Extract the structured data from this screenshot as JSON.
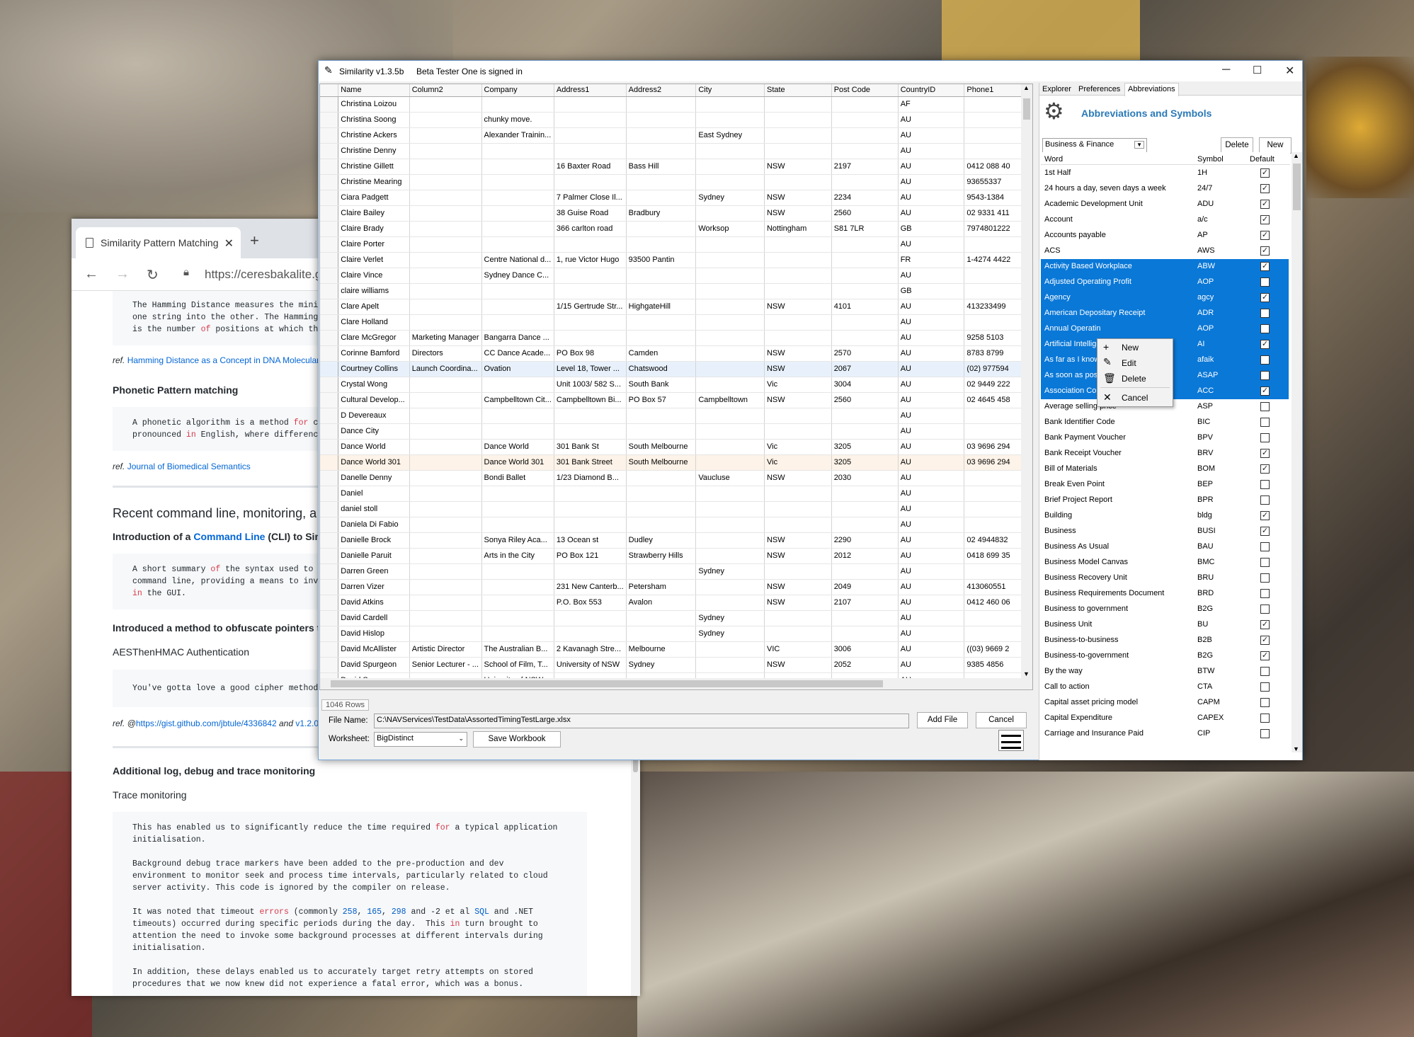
{
  "app": {
    "title": "Similarity v1.3.5b",
    "signed_in": "Beta Tester One is signed in",
    "columns": [
      "Name",
      "Column2",
      "Company",
      "Address1",
      "Address2",
      "City",
      "State",
      "Post Code",
      "CountryID",
      "Phone1"
    ],
    "rows": [
      [
        "Christina Loizou",
        "",
        "",
        "",
        "",
        "",
        "",
        "",
        "AF",
        ""
      ],
      [
        "Christina Soong",
        "",
        "chunky move.",
        "",
        "",
        "",
        "",
        "",
        "AU",
        ""
      ],
      [
        "Christine Ackers",
        "",
        "Alexander Trainin...",
        "",
        "",
        "East Sydney",
        "",
        "",
        "AU",
        ""
      ],
      [
        "Christine Denny",
        "",
        "",
        "",
        "",
        "",
        "",
        "",
        "AU",
        ""
      ],
      [
        "Christine Gillett",
        "",
        "",
        "16 Baxter Road",
        "Bass Hill",
        "",
        "NSW",
        "2197",
        "AU",
        "0412 088 40"
      ],
      [
        "Christine Mearing",
        "",
        "",
        "",
        "",
        "",
        "",
        "",
        "AU",
        "93655337"
      ],
      [
        "Ciara Padgett",
        "",
        "",
        "7 Palmer Close Il...",
        "",
        "Sydney",
        "NSW",
        "2234",
        "AU",
        "9543-1384"
      ],
      [
        "Claire Bailey",
        "",
        "",
        "38 Guise Road",
        "Bradbury",
        "",
        "NSW",
        "2560",
        "AU",
        "02 9331 411"
      ],
      [
        "Claire Brady",
        "",
        "",
        "366 carlton road",
        "",
        "Worksop",
        "Nottingham",
        "S81 7LR",
        "GB",
        "7974801222"
      ],
      [
        "Claire Porter",
        "",
        "",
        "",
        "",
        "",
        "",
        "",
        "AU",
        ""
      ],
      [
        "Claire Verlet",
        "",
        "Centre National d...",
        "1, rue Victor Hugo",
        "93500 Pantin",
        "",
        "",
        "",
        "FR",
        "1-4274 4422"
      ],
      [
        "Claire Vince",
        "",
        "Sydney Dance C...",
        "",
        "",
        "",
        "",
        "",
        "AU",
        ""
      ],
      [
        "claire williams",
        "",
        "",
        "",
        "",
        "",
        "",
        "",
        "GB",
        ""
      ],
      [
        "Clare Apelt",
        "",
        "",
        "1/15 Gertrude Str...",
        "HighgateHill",
        "",
        "NSW",
        "4101",
        "AU",
        "413233499"
      ],
      [
        "Clare Holland",
        "",
        "",
        "",
        "",
        "",
        "",
        "",
        "AU",
        ""
      ],
      [
        "Clare McGregor",
        "Marketing Manager",
        "Bangarra Dance ...",
        "",
        "",
        "",
        "",
        "",
        "AU",
        "9258 5103"
      ],
      [
        "Corinne Bamford",
        "Directors",
        "CC Dance Acade...",
        "PO Box 98",
        "Camden",
        "",
        "NSW",
        "2570",
        "AU",
        "8783 8799"
      ],
      [
        "Courtney Collins",
        "Launch Coordina...",
        "Ovation",
        "Level 18, Tower ...",
        "Chatswood",
        "",
        "NSW",
        "2067",
        "AU",
        "(02) 977594"
      ],
      [
        "Crystal Wong",
        "",
        "",
        "Unit 1003/ 582 S...",
        "South Bank",
        "",
        "Vic",
        "3004",
        "AU",
        "02 9449 222"
      ],
      [
        "Cultural Develop...",
        "",
        "Campbelltown Cit...",
        "Campbelltown Bi...",
        "PO Box 57",
        "Campbelltown",
        "NSW",
        "2560",
        "AU",
        "02 4645 458"
      ],
      [
        "D Devereaux",
        "",
        "",
        "",
        "",
        "",
        "",
        "",
        "AU",
        ""
      ],
      [
        "Dance City",
        "",
        "",
        "",
        "",
        "",
        "",
        "",
        "AU",
        ""
      ],
      [
        "Dance World",
        "",
        "Dance World",
        "301 Bank St",
        "South Melbourne",
        "",
        "Vic",
        "3205",
        "AU",
        "03 9696 294"
      ],
      [
        "Dance World 301",
        "",
        "Dance World 301",
        "301 Bank Street",
        "South Melbourne",
        "",
        "Vic",
        "3205",
        "AU",
        "03 9696 294"
      ],
      [
        "Danelle Denny",
        "",
        "Bondi Ballet",
        "1/23 Diamond B...",
        "",
        "Vaucluse",
        "NSW",
        "2030",
        "AU",
        ""
      ],
      [
        "Daniel",
        "",
        "",
        "",
        "",
        "",
        "",
        "",
        "AU",
        ""
      ],
      [
        "daniel stoll",
        "",
        "",
        "",
        "",
        "",
        "",
        "",
        "AU",
        ""
      ],
      [
        "Daniela Di Fabio",
        "",
        "",
        "",
        "",
        "",
        "",
        "",
        "AU",
        ""
      ],
      [
        "Danielle Brock",
        "",
        "Sonya Riley Aca...",
        "13 Ocean st",
        "Dudley",
        "",
        "NSW",
        "2290",
        "AU",
        "02 4944832"
      ],
      [
        "Danielle Paruit",
        "",
        "Arts in the City",
        "PO Box 121",
        "Strawberry Hills",
        "",
        "NSW",
        "2012",
        "AU",
        "0418 699 35"
      ],
      [
        "Darren Green",
        "",
        "",
        "",
        "",
        "Sydney",
        "",
        "",
        "AU",
        ""
      ],
      [
        "Darren Vizer",
        "",
        "",
        "231 New Canterb...",
        "Petersham",
        "",
        "NSW",
        "2049",
        "AU",
        "413060551"
      ],
      [
        "David Atkins",
        "",
        "",
        "P.O. Box 553",
        "Avalon",
        "",
        "NSW",
        "2107",
        "AU",
        "0412 460 06"
      ],
      [
        "David Cardell",
        "",
        "",
        "",
        "",
        "Sydney",
        "",
        "",
        "AU",
        ""
      ],
      [
        "David Hislop",
        "",
        "",
        "",
        "",
        "Sydney",
        "",
        "",
        "AU",
        ""
      ],
      [
        "David McAllister",
        "Artistic Director",
        "The Australian B...",
        "2 Kavanagh Stre...",
        "Melbourne",
        "",
        "VIC",
        "3006",
        "AU",
        "((03) 9669 2"
      ],
      [
        "David Spurgeon",
        "Senior Lecturer - ...",
        "School of Film, T...",
        "University of NSW",
        "Sydney",
        "",
        "NSW",
        "2052",
        "AU",
        "9385 4856"
      ],
      [
        "David Spurgeon",
        "",
        "Univerity of NSW",
        "",
        "",
        "",
        "",
        "",
        "AU",
        ""
      ]
    ],
    "row_count": "1046 Rows",
    "file_label": "File Name:",
    "file_value": "C:\\NAVServices\\TestData\\AssortedTimingTestLarge.xlsx",
    "add_file": "Add File",
    "cancel": "Cancel",
    "worksheet_label": "Worksheet:",
    "worksheet_value": "BigDistinct",
    "save_workbook": "Save Workbook"
  },
  "panel": {
    "tabs": [
      "Explorer",
      "Preferences",
      "Abbreviations"
    ],
    "heading": "Abbreviations and Symbols",
    "category": "Business & Finance",
    "delete": "Delete",
    "new": "New",
    "headers": [
      "Word",
      "Symbol",
      "Default"
    ],
    "items": [
      {
        "w": "1st Half",
        "s": "1H",
        "c": "✓",
        "sel": false
      },
      {
        "w": "24 hours a day, seven days a week",
        "s": "24/7",
        "c": "✓",
        "sel": false
      },
      {
        "w": "Academic Development Unit",
        "s": "ADU",
        "c": "✓",
        "sel": false
      },
      {
        "w": "Account",
        "s": "a/c",
        "c": "✓",
        "sel": false
      },
      {
        "w": "Accounts payable",
        "s": "AP",
        "c": "✓",
        "sel": false
      },
      {
        "w": "ACS",
        "s": "AWS",
        "c": "✓",
        "sel": false
      },
      {
        "w": "Activity Based Workplace",
        "s": "ABW",
        "c": "✓",
        "sel": true
      },
      {
        "w": "Adjusted Operating Profit",
        "s": "AOP",
        "c": "",
        "sel": true
      },
      {
        "w": "Agency",
        "s": "agcy",
        "c": "✓",
        "sel": true
      },
      {
        "w": "American Depositary Receipt",
        "s": "ADR",
        "c": "",
        "sel": true
      },
      {
        "w": "Annual Operatin",
        "s": "AOP",
        "c": "",
        "sel": true
      },
      {
        "w": "Artificial Intellige",
        "s": "AI",
        "c": "✓",
        "sel": true
      },
      {
        "w": "As far as I know",
        "s": "afaik",
        "c": "",
        "sel": true
      },
      {
        "w": "As soon as poss",
        "s": "ASAP",
        "c": "",
        "sel": true
      },
      {
        "w": "Association Con",
        "s": "ACC",
        "c": "✓",
        "sel": true
      },
      {
        "w": "Average selling price",
        "s": "ASP",
        "c": "",
        "sel": false
      },
      {
        "w": "Bank Identifier Code",
        "s": "BIC",
        "c": "",
        "sel": false
      },
      {
        "w": "Bank Payment Voucher",
        "s": "BPV",
        "c": "",
        "sel": false
      },
      {
        "w": "Bank Receipt Voucher",
        "s": "BRV",
        "c": "✓",
        "sel": false
      },
      {
        "w": "Bill of Materials",
        "s": "BOM",
        "c": "✓",
        "sel": false
      },
      {
        "w": "Break Even Point",
        "s": "BEP",
        "c": "",
        "sel": false
      },
      {
        "w": "Brief Project Report",
        "s": "BPR",
        "c": "",
        "sel": false
      },
      {
        "w": "Building",
        "s": "bldg",
        "c": "✓",
        "sel": false
      },
      {
        "w": "Business",
        "s": "BUSI",
        "c": "✓",
        "sel": false
      },
      {
        "w": "Business As Usual",
        "s": "BAU",
        "c": "",
        "sel": false
      },
      {
        "w": "Business Model Canvas",
        "s": "BMC",
        "c": "",
        "sel": false
      },
      {
        "w": "Business Recovery Unit",
        "s": "BRU",
        "c": "",
        "sel": false
      },
      {
        "w": "Business Requirements Document",
        "s": "BRD",
        "c": "",
        "sel": false
      },
      {
        "w": "Business to government",
        "s": "B2G",
        "c": "",
        "sel": false
      },
      {
        "w": "Business Unit",
        "s": "BU",
        "c": "✓",
        "sel": false
      },
      {
        "w": "Business-to-business",
        "s": "B2B",
        "c": "✓",
        "sel": false
      },
      {
        "w": "Business-to-government",
        "s": "B2G",
        "c": "✓",
        "sel": false
      },
      {
        "w": "By the way",
        "s": "BTW",
        "c": "",
        "sel": false
      },
      {
        "w": "Call to action",
        "s": "CTA",
        "c": "",
        "sel": false
      },
      {
        "w": "Capital asset pricing model",
        "s": "CAPM",
        "c": "",
        "sel": false
      },
      {
        "w": "Capital Expenditure",
        "s": "CAPEX",
        "c": "",
        "sel": false
      },
      {
        "w": "Carriage and Insurance Paid",
        "s": "CIP",
        "c": "",
        "sel": false
      }
    ],
    "menu": [
      "New",
      "Edit",
      "Delete",
      "Cancel"
    ]
  },
  "browser": {
    "tab_title": "Similarity Pattern Matching",
    "url": "https://ceresbakalite.gi",
    "p1": "The Hamming Distance measures the minim\none string into the other. The Hamming\nis the number of positions at which the",
    "ref1_prefix": "ref.",
    "ref1_link": "Hamming Distance as a Concept in DNA Molecular",
    "h_phonetic": "Phonetic Pattern matching",
    "p2": "A phonetic algorithm is a method for co\npronounced in English, where differenc",
    "ref2_prefix": "ref.",
    "ref2_link": "Journal of Biomedical Semantics",
    "h_recent": "Recent command line, monitoring, a",
    "h_intro_a": "Introduction of a ",
    "h_intro_link": "Command Line",
    "h_intro_b": " (CLI) to Sim",
    "p3": "A short summary of the syntax used to ca\ncommand line, providing a means to invok\nin the GUI.",
    "h_obf": "Introduced a method to obfuscate pointers t",
    "aes": "AESThenHMAC Authentication",
    "p4": "You've gotta love a good cipher methodol",
    "ref3_prefix": "ref. @",
    "ref3_link": "https://gist.github.com/jbtule/4336842",
    "ref3_mid": " and ",
    "ref3_v": "v1.2.0",
    "h_log": "Additional log, debug and trace monitoring",
    "trace": "Trace monitoring",
    "p5": "This has enabled us to significantly reduce the time required for a typical application\ninitialisation.\n\nBackground debug trace markers have been added to the pre-production and dev\nenvironment to monitor seek and process time intervals, particularly related to cloud\nserver activity. This code is ignored by the compiler on release.\n\nIt was noted that timeout errors (commonly 258, 165, 298 and -2 et al SQL and .NET\ntimeouts) occurred during specific periods during the day.  This in turn brought to\nattention the need to invoke some background processes at different intervals during\ninitialisation.\n\nIn addition, these delays enabled us to accurately target retry attempts on stored\nprocedures that we now knew did not experience a fatal error, which was a bonus."
  }
}
